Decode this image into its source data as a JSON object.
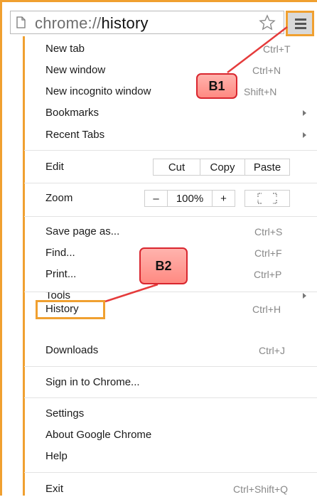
{
  "omnibox": {
    "url_prefix": "chrome://",
    "url_host": "history"
  },
  "menu": {
    "new_tab": {
      "label": "New tab",
      "shortcut": "Ctrl+T"
    },
    "new_window": {
      "label": "New window",
      "shortcut": "Ctrl+N"
    },
    "new_incognito": {
      "label": "New incognito window",
      "shortcut_visible": "Shift+N"
    },
    "bookmarks": {
      "label": "Bookmarks"
    },
    "recent_tabs": {
      "label": "Recent Tabs"
    },
    "edit": {
      "label": "Edit",
      "cut": "Cut",
      "copy": "Copy",
      "paste": "Paste"
    },
    "zoom": {
      "label": "Zoom",
      "minus": "–",
      "level": "100%",
      "plus": "+"
    },
    "save_page": {
      "label": "Save page as...",
      "shortcut": "Ctrl+S"
    },
    "find": {
      "label": "Find...",
      "shortcut": "Ctrl+F"
    },
    "print": {
      "label": "Print...",
      "shortcut": "Ctrl+P"
    },
    "tools": {
      "label": "Tools"
    },
    "history": {
      "label": "History",
      "shortcut": "Ctrl+H"
    },
    "downloads": {
      "label": "Downloads",
      "shortcut": "Ctrl+J"
    },
    "sign_in": {
      "label": "Sign in to Chrome..."
    },
    "settings": {
      "label": "Settings"
    },
    "about": {
      "label": "About Google Chrome"
    },
    "help": {
      "label": "Help"
    },
    "exit": {
      "label": "Exit",
      "shortcut": "Ctrl+Shift+Q"
    }
  },
  "annotations": {
    "b1": "B1",
    "b2": "B2"
  },
  "colors": {
    "highlight": "#f0a030",
    "callout_border": "#d9262f",
    "callout_fill": "#ff9d96",
    "arrow": "#e53b3b"
  }
}
